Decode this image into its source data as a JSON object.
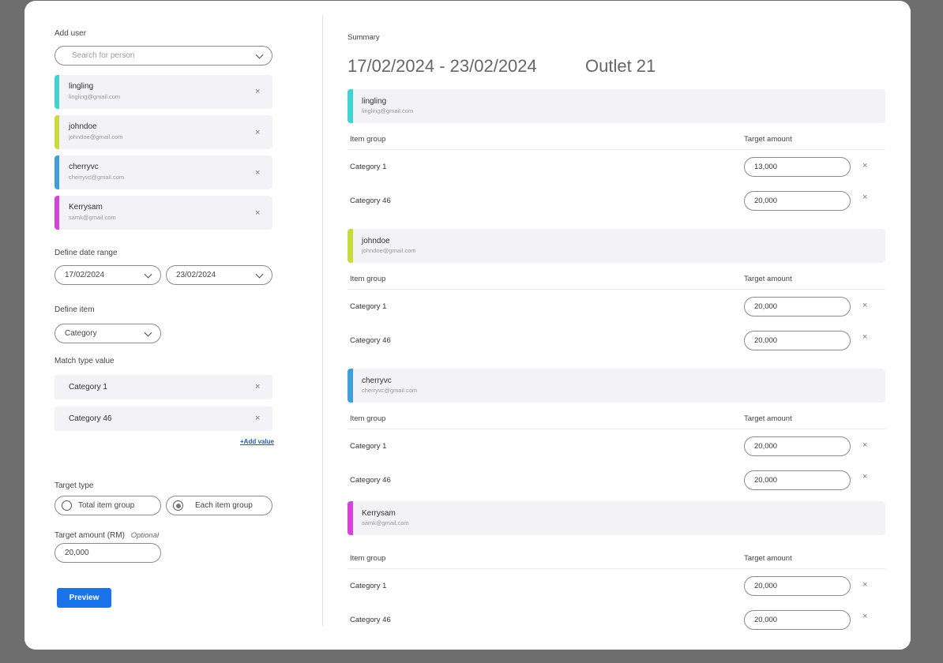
{
  "left": {
    "add_user_label": "Add user",
    "search_placeholder": "Search for person",
    "users": [
      {
        "name": "lingling",
        "email": "lingling@gmail.com",
        "color": "#3fd4d0"
      },
      {
        "name": "johndoe",
        "email": "johndoe@gmail.com",
        "color": "#c8dc3c"
      },
      {
        "name": "cherryvc",
        "email": "cherryvc@gmail.com",
        "color": "#3f9fdb"
      },
      {
        "name": "Kerrysam",
        "email": "samk@gmail.com",
        "color": "#d544d8"
      }
    ],
    "date_range_label": "Define date range",
    "date_start": "17/02/2024",
    "date_end": "23/02/2024",
    "define_item_label": "Define item",
    "item_select_value": "Category",
    "match_type_label": "Match type value",
    "match_values": [
      "Category 1",
      "Category 46"
    ],
    "add_value_link": "+Add value",
    "target_type_label": "Target type",
    "target_type_options": [
      "Total item group",
      "Each item group"
    ],
    "target_type_selected": "Each item group",
    "target_amount_label": "Target amount (RM)",
    "target_amount_optional": "Optional",
    "target_amount_value": "20,000",
    "preview_button": "Preview"
  },
  "summary": {
    "label": "Summary",
    "date_range": "17/02/2024 - 23/02/2024",
    "outlet": "Outlet 21",
    "col_item_group": "Item group",
    "col_target_amount": "Target amount",
    "users": [
      {
        "name": "lingling",
        "email": "lingling@gmail.com",
        "color": "#3fd4d0",
        "rows": [
          {
            "category": "Category 1",
            "amount": "13,000"
          },
          {
            "category": "Category 46",
            "amount": "20,000"
          }
        ]
      },
      {
        "name": "johndoe",
        "email": "johndoe@gmail.com",
        "color": "#c8dc3c",
        "rows": [
          {
            "category": "Category 1",
            "amount": "20,000"
          },
          {
            "category": "Category 46",
            "amount": "20,000"
          }
        ]
      },
      {
        "name": "cherryvc",
        "email": "cherryvc@gmail.com",
        "color": "#3f9fdb",
        "rows": [
          {
            "category": "Category 1",
            "amount": "20,000"
          },
          {
            "category": "Category 46",
            "amount": "20,000"
          }
        ]
      },
      {
        "name": "Kerrysam",
        "email": "samk@gmail.com",
        "color": "#d544d8",
        "rows": [
          {
            "category": "Category 1",
            "amount": "20,000"
          },
          {
            "category": "Category 46",
            "amount": "20,000"
          }
        ]
      }
    ]
  },
  "icons": {
    "close": "×"
  }
}
